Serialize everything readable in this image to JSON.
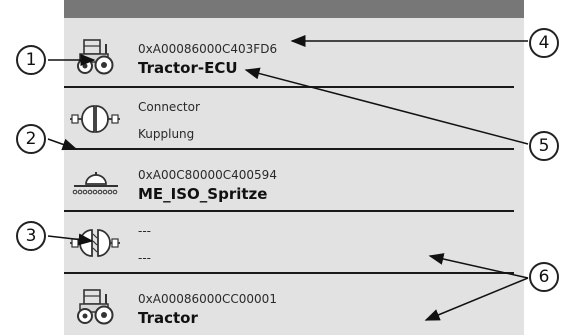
{
  "devices": [
    {
      "id": "0xA00086000C403FD6",
      "name": "Tractor-ECU",
      "icon": "tractor-icon"
    },
    {
      "line1": "Connector",
      "line2": "Kupplung",
      "icon": "connector-icon"
    },
    {
      "id": "0xA00C80000C400594",
      "name": "ME_ISO_Spritze",
      "icon": "sprayer-icon"
    },
    {
      "line1": "---",
      "line2": "---",
      "icon": "connector-split-icon"
    },
    {
      "id": "0xA00086000CC00001",
      "name": "Tractor",
      "icon": "tractor-icon"
    }
  ],
  "callouts": [
    "1",
    "2",
    "3",
    "4",
    "5",
    "6"
  ]
}
